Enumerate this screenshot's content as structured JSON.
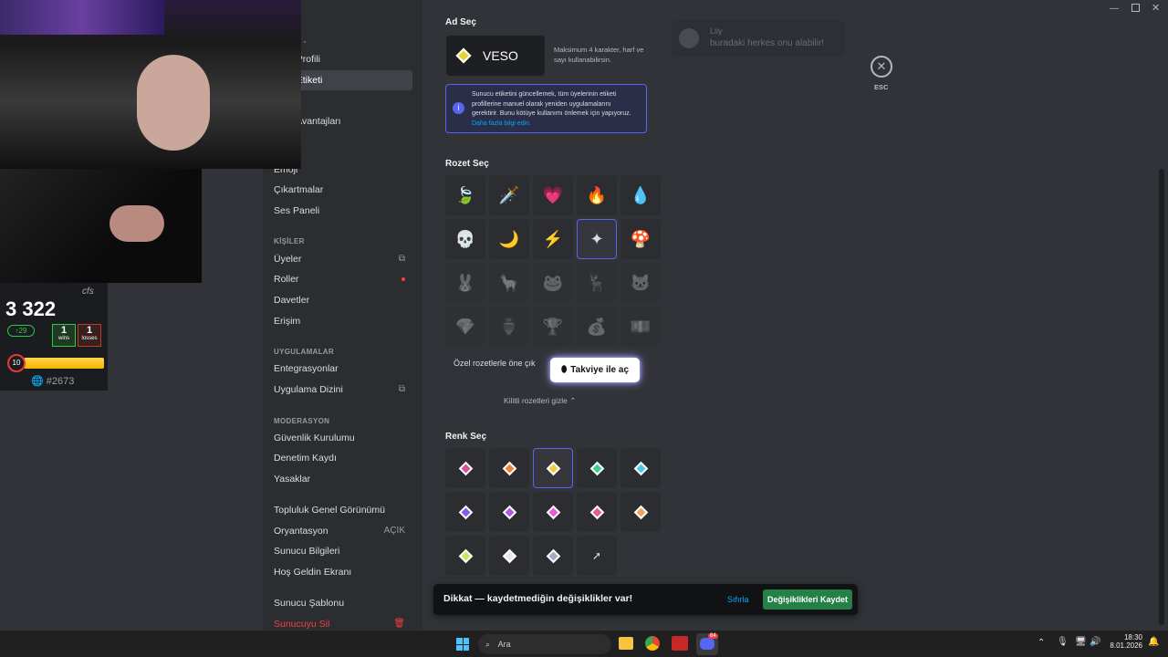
{
  "sidebar": {
    "header_general": "LAM -",
    "items_top": [
      {
        "label": "u Profili"
      },
      {
        "label": "u Etiketi",
        "active": true
      },
      {
        "label": "n"
      },
      {
        "label": "e Avantajları"
      },
      {
        "label": "Emoji"
      },
      {
        "label": "Çıkartmalar"
      },
      {
        "label": "Ses Paneli"
      }
    ],
    "header_people": "KİŞİLER",
    "people": [
      {
        "label": "Üyeler"
      },
      {
        "label": "Roller"
      },
      {
        "label": "Davetler"
      },
      {
        "label": "Erişim"
      }
    ],
    "header_apps": "UYGULAMALAR",
    "apps": [
      {
        "label": "Entegrasyonlar"
      },
      {
        "label": "Uygulama Dizini"
      }
    ],
    "header_mod": "MODERASYON",
    "mod": [
      {
        "label": "Güvenlik Kurulumu"
      },
      {
        "label": "Denetim Kaydı"
      },
      {
        "label": "Yasaklar"
      }
    ],
    "community": [
      {
        "label": "Topluluk Genel Görünümü"
      },
      {
        "label": "Oryantasyon",
        "right": "AÇIK"
      },
      {
        "label": "Sunucu Bilgileri"
      },
      {
        "label": "Hoş Geldin Ekranı"
      }
    ],
    "template": "Sunucu Şablonu",
    "delete": "Sunucuyu Sil"
  },
  "main": {
    "name_title": "Ad Seç",
    "tag_value": "VESO",
    "tag_hint": "Maksimum 4 karakter, harf ve sayı kullanabilirsin.",
    "info_text": "Sunucu etiketini güncellemek, tüm üyelerinin etiketi profillerine manuel olarak yeniden uygulamalarını gerektirir. Bunu kötüye kullanımı önlemek için yapıyoruz.",
    "info_link": "Daha fazla bilgi edin.",
    "badge_title": "Rozet Seç",
    "badges": [
      "🍃",
      "🗡️",
      "💗",
      "🔥",
      "💧",
      "💀",
      "🌙",
      "⚡",
      "✦",
      "🍄",
      "🐰",
      "🦙",
      "🐸",
      "🦌",
      "🐱",
      "💎",
      "🏺",
      "🏆",
      "💰",
      "💵"
    ],
    "promo_text": "Özel rozetlerle öne çık",
    "boost_button": "Takviye ile aç",
    "hide_locked": "Kilitli rozetleri gizle",
    "color_title": "Renk Seç",
    "colors": [
      "#d94fa0",
      "#e8853a",
      "#e8d23a",
      "#3ad08f",
      "#4fc9e0",
      "#8a5be8",
      "#b05be8",
      "#e85bd1",
      "#e85b8a",
      "#e8a85b",
      "#c8e85b",
      "#e8e8e8",
      "#a8a8c8"
    ],
    "custom_color_icon": "eyedropper-icon",
    "unsaved_text": "Dikkat — kaydetmediğin değişiklikler var!",
    "reset": "Sıfırla",
    "save": "Değişiklikleri Kaydet",
    "esc": "ESC"
  },
  "preview": {
    "name": "Lily",
    "text": "buradaki herkes onu alabilir!"
  },
  "overlay": {
    "rating": "3 322",
    "brand": "cfs",
    "delta": "29",
    "wins": "1",
    "wins_label": "wins",
    "losses": "1",
    "losses_label": "losses",
    "level": "10",
    "rank": "#2673"
  },
  "taskbar": {
    "search": "Ara",
    "time": "18:30",
    "date": "8.01.2026",
    "discord_badge": "84"
  },
  "accent": {
    "blurple": "#5865f2",
    "green": "#248046",
    "red": "#f23f43"
  }
}
